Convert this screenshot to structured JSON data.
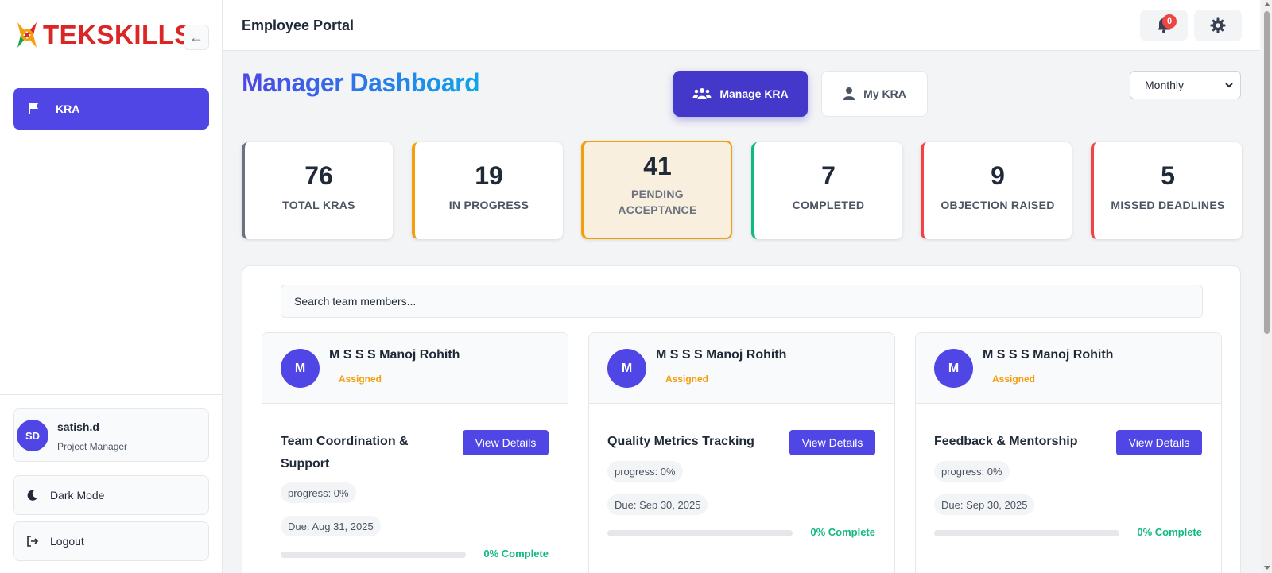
{
  "brand": {
    "logo_text": "TEKSKILLS"
  },
  "sidebar": {
    "collapse_icon": "arrow-left-icon",
    "items": [
      {
        "label": "KRA",
        "icon": "flag-icon",
        "active": true
      }
    ],
    "user": {
      "initials": "SD",
      "name": "satish.d",
      "role": "Project Manager"
    },
    "dark_mode_label": "Dark Mode",
    "logout_label": "Logout"
  },
  "header": {
    "title": "Employee Portal",
    "notification_count": "0"
  },
  "main": {
    "title": "Manager Dashboard",
    "manage_kra_label": "Manage KRA",
    "my_kra_label": "My KRA",
    "period": "Monthly",
    "stats": [
      {
        "value": "76",
        "label": "TOTAL KRAS",
        "color": "#6b7280"
      },
      {
        "value": "19",
        "label": "IN PROGRESS",
        "color": "#f59e0b"
      },
      {
        "value": "41",
        "label": "PENDING ACCEPTANCE",
        "color": "#f59e0b"
      },
      {
        "value": "7",
        "label": "COMPLETED",
        "color": "#10b981"
      },
      {
        "value": "9",
        "label": "OBJECTION RAISED",
        "color": "#ef4444"
      },
      {
        "value": "5",
        "label": "MISSED DEADLINES",
        "color": "#ef4444"
      }
    ],
    "search_placeholder": "Search team members...",
    "cards": [
      {
        "initial": "M",
        "name": "M S S S Manoj Rohith",
        "status": "Assigned",
        "title": "Team Coordination & Support",
        "progress_label": "progress: 0%",
        "due": "Due: Aug 31, 2025",
        "progress": 0,
        "complete_label": "0% Complete",
        "button": "View Details"
      },
      {
        "initial": "M",
        "name": "M S S S Manoj Rohith",
        "status": "Assigned",
        "title": "Quality Metrics Tracking",
        "progress_label": "progress: 0%",
        "due": "Due: Sep 30, 2025",
        "progress": 0,
        "complete_label": "0% Complete",
        "button": "View Details"
      },
      {
        "initial": "M",
        "name": "M S S S Manoj Rohith",
        "status": "Assigned",
        "title": "Feedback & Mentorship",
        "progress_label": "progress: 0%",
        "due": "Due: Sep 30, 2025",
        "progress": 0,
        "complete_label": "0% Complete",
        "button": "View Details"
      }
    ]
  },
  "colors": {
    "accent": "#4f46e5",
    "success": "#10b981",
    "warning": "#f59e0b",
    "danger": "#ef4444"
  }
}
